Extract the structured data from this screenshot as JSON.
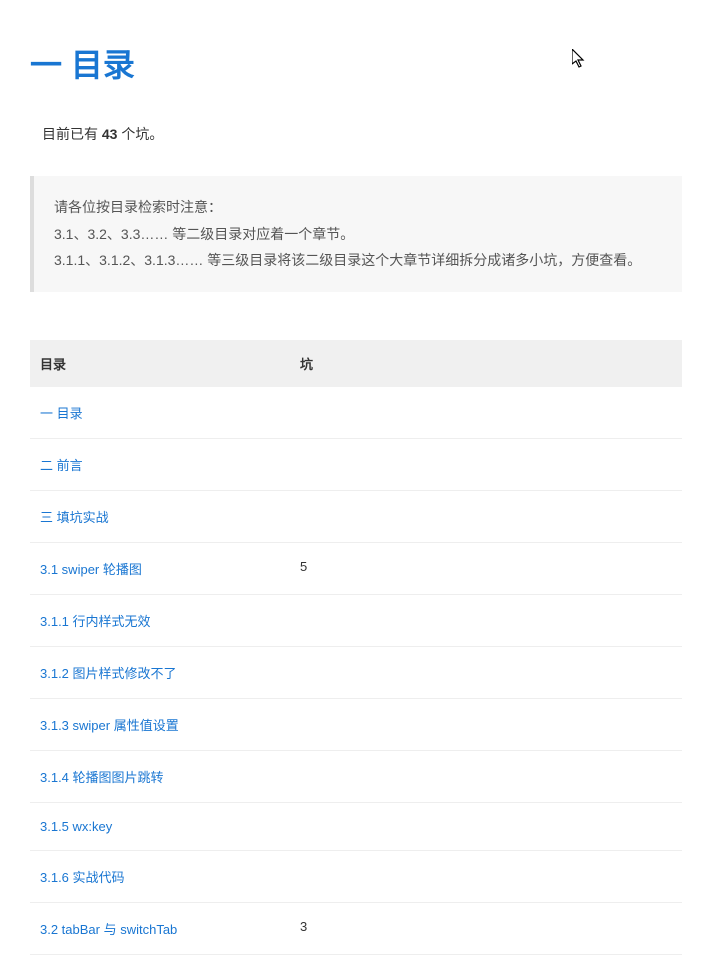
{
  "title": "一 目录",
  "intro": {
    "prefix": "目前已有 ",
    "count": "43",
    "suffix": " 个坑。"
  },
  "notice": {
    "line1": "请各位按目录检索时注意：",
    "line2": "3.1、3.2、3.3…… 等二级目录对应着一个章节。",
    "line3": "3.1.1、3.1.2、3.1.3…… 等三级目录将该二级目录这个大章节详细拆分成诸多小坑，方便查看。"
  },
  "tableHeaders": {
    "col1": "目录",
    "col2": "坑"
  },
  "tocItems": [
    {
      "label": "一 目录",
      "count": "",
      "level": 0
    },
    {
      "label": "二 前言",
      "count": "",
      "level": 0
    },
    {
      "label": "三 填坑实战",
      "count": "",
      "level": 0
    },
    {
      "label": "3.1 swiper 轮播图",
      "count": "5",
      "level": 1
    },
    {
      "label": "3.1.1 行内样式无效",
      "count": "",
      "level": 2
    },
    {
      "label": "3.1.2 图片样式修改不了",
      "count": "",
      "level": 2
    },
    {
      "label": "3.1.3 swiper 属性值设置",
      "count": "",
      "level": 2
    },
    {
      "label": "3.1.4 轮播图图片跳转",
      "count": "",
      "level": 2
    },
    {
      "label": "3.1.5 wx:key",
      "count": "",
      "level": 2
    },
    {
      "label": "3.1.6 实战代码",
      "count": "",
      "level": 2
    },
    {
      "label": "3.2 tabBar 与 switchTab",
      "count": "3",
      "level": 1
    }
  ]
}
